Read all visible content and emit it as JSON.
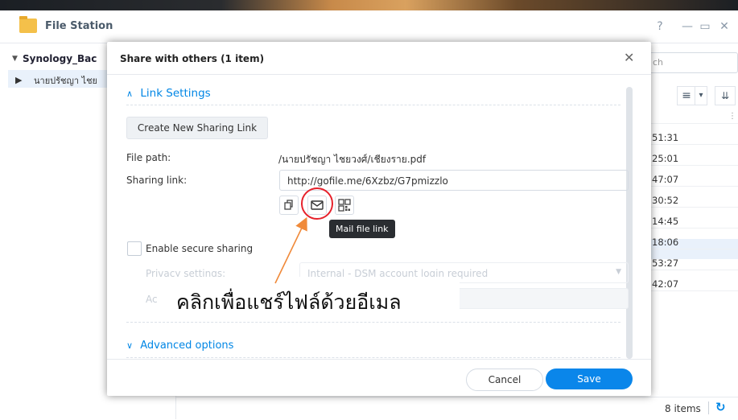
{
  "file_station": {
    "title": "File Station",
    "controls": [
      "?",
      "—",
      "▭",
      "✕"
    ],
    "sidebar": {
      "root": "Synology_Bac",
      "child": "นายปรัชญา ไชย"
    },
    "search_text": "ch",
    "times": [
      "51:31",
      "25:01",
      "47:07",
      "30:52",
      "14:45",
      "18:06",
      "53:27",
      "42:07"
    ],
    "status": {
      "items": "8 items"
    }
  },
  "dialog": {
    "title": "Share with others (1 item)",
    "link_settings": {
      "header": "Link Settings",
      "create_button": "Create New Sharing Link",
      "file_path_label": "File path:",
      "file_path_value": "/นายปรัชญา ไชยวงศ์/เชียงราย.pdf",
      "sharing_link_label": "Sharing link:",
      "sharing_link_value": "http://gofile.me/6Xzbz/G7pmizzlo",
      "tooltip": "Mail file link",
      "secure_sharing_label": "Enable secure sharing",
      "privacy_label": "Privacy settings:",
      "privacy_value": "Internal - DSM account login required",
      "access_label": "Ac"
    },
    "advanced": {
      "header": "Advanced options"
    },
    "buttons": {
      "cancel": "Cancel",
      "save": "Save"
    }
  },
  "annotation": {
    "text": "คลิกเพื่อแชร์ไฟล์ด้วยอีเมล",
    "color": "#f08a3a",
    "highlight_color": "#e6222c"
  },
  "colors": {
    "accent": "#0086e5",
    "save_button": "#0a86ea"
  }
}
